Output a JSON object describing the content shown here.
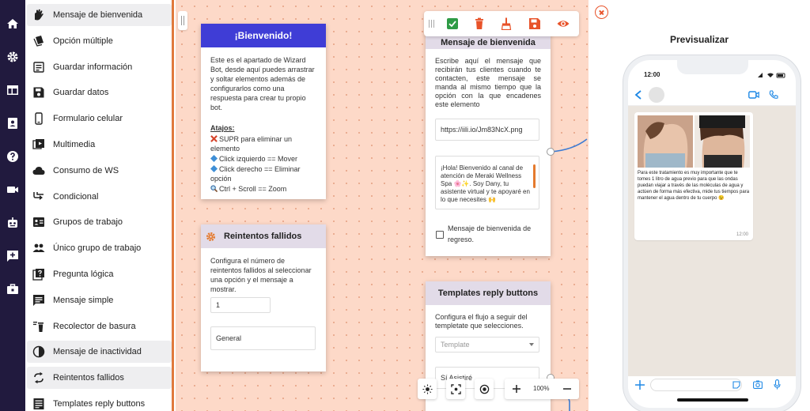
{
  "colors": {
    "rail": "#211a3e",
    "accent": "#e07a3c",
    "canvas": "#fdd9c8",
    "header_purple": "#3f3dd6",
    "header_lilac": "#e2dbe8"
  },
  "rail_icons": [
    "home-icon",
    "gear-icon",
    "layout-icon",
    "contacts-icon",
    "help-icon",
    "video-icon",
    "robot-icon",
    "add-message-icon",
    "briefcase-icon"
  ],
  "menu": {
    "items": [
      {
        "label": "Mensaje de bienvenida",
        "icon": "welcome-hand-icon",
        "highlight": true
      },
      {
        "label": "Opción múltiple",
        "icon": "multiple-option-icon",
        "highlight": false
      },
      {
        "label": "Guardar información",
        "icon": "save-info-icon",
        "highlight": false
      },
      {
        "label": "Guardar datos",
        "icon": "save-data-icon",
        "highlight": false
      },
      {
        "label": "Formulario celular",
        "icon": "mobile-form-icon",
        "highlight": false
      },
      {
        "label": "Multimedia",
        "icon": "multimedia-icon",
        "highlight": false
      },
      {
        "label": "Consumo de WS",
        "icon": "cloud-icon",
        "highlight": false
      },
      {
        "label": "Condicional",
        "icon": "conditional-icon",
        "highlight": false
      },
      {
        "label": "Grupos de trabajo",
        "icon": "work-groups-icon",
        "highlight": false
      },
      {
        "label": "Único grupo de trabajo",
        "icon": "single-group-icon",
        "highlight": false
      },
      {
        "label": "Pregunta lógica",
        "icon": "logic-question-icon",
        "highlight": false
      },
      {
        "label": "Mensaje simple",
        "icon": "simple-message-icon",
        "highlight": false
      },
      {
        "label": "Recolector de basura",
        "icon": "trash-collector-icon",
        "highlight": false
      },
      {
        "label": "Mensaje de inactividad",
        "icon": "inactivity-icon",
        "highlight": true
      },
      {
        "label": "Reintentos fallidos",
        "icon": "retry-icon",
        "highlight": true
      },
      {
        "label": "Templates reply buttons",
        "icon": "template-buttons-icon",
        "highlight": false
      }
    ]
  },
  "welcome_card": {
    "title": "¡Bienvenido!",
    "intro": "Este es el apartado de Wizard Bot, desde aquí puedes arrastrar y soltar elementos además de configurarlos como una respuesta para crear tu propio bot.",
    "shortcuts_title": "Atajos:",
    "shortcuts": [
      "SUPR para eliminar un elemento",
      "Click izquierdo == Mover",
      "Click derecho == Eliminar opción",
      "Ctrl + Scroll == Zoom"
    ]
  },
  "retries_card": {
    "title": "Reintentos fallidos",
    "description": "Configura el número de reintentos fallidos al seleccionar una opción y el mensaje a mostrar.",
    "count_value": "1",
    "message_value": "General"
  },
  "welcome_message_card": {
    "title": "Mensaje de bienvenida",
    "description": "Escribe aquí el mensaje que recibirán tus clientes cuando te contacten, este mensaje se manda al mismo tiempo que la opción con la que encadenes este elemento",
    "url_value": "https://iili.io/Jm83NcX.png",
    "message_value": "¡Hola! Bienvenido al canal de atención de Meraki Wellness Spa 🌸✨. Soy Dany, tu asistente virtual y te apoyaré en lo que necesites 🙌",
    "checkbox_label": "Mensaje de bienvenida de regreso."
  },
  "templates_card": {
    "title": "Templates reply buttons",
    "description": "Configura el flujo a seguir del templetate que selecciones.",
    "select_placeholder": "Template",
    "option_value": "Sí Asistiré"
  },
  "toolbar": {
    "buttons": [
      "check-icon",
      "delete-icon",
      "clean-icon",
      "save-icon",
      "eye-icon"
    ]
  },
  "zoom": {
    "level": "100%"
  },
  "preview": {
    "title": "Previsualizar",
    "status_time": "12:00",
    "message_text": "Para este tratamiento es muy importante que te tomes 1 litro de agua previo para que las ondas puedan viajar a través de las moléculas de agua y actúen de forma más efectiva, mide tus tiempos para mantener el agua dentro de tu cuerpo 😉",
    "message_time": "12:00"
  }
}
